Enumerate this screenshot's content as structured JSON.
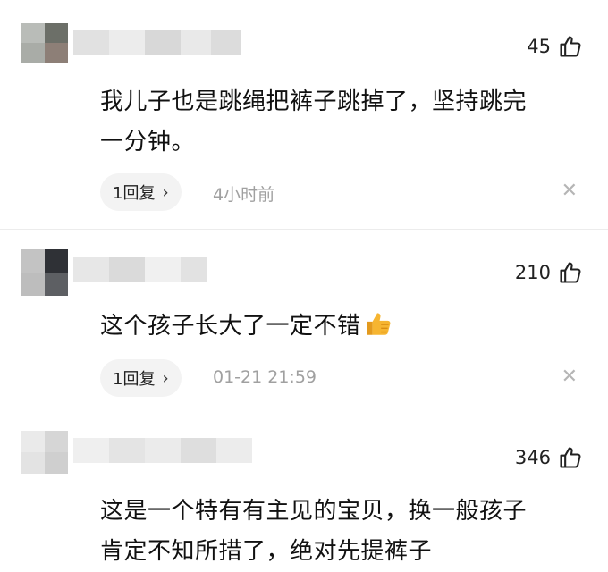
{
  "comments": [
    {
      "likes": "45",
      "text": "我儿子也是跳绳把裤子跳掉了，坚持跳完\n一分钟。",
      "reply_label": "1回复",
      "time": "4小时前"
    },
    {
      "likes": "210",
      "text": "这个孩子长大了一定不错",
      "reply_label": "1回复",
      "time": "01-21 21:59"
    },
    {
      "likes": "346",
      "text": "这是一个特有有主见的宝贝，换一般孩子\n肯定不知所措了，绝对先提裤子"
    }
  ],
  "icons": {
    "like": "thumbs-up-outline-icon",
    "emoji": "thumbs-up-emoji-icon",
    "dismiss": "close-icon",
    "chevron": "chevron-right-icon"
  },
  "colors": {
    "text": "#111111",
    "muted": "#a0a0a0",
    "pill_bg": "#f3f3f3",
    "emoji": "#f6b531"
  }
}
